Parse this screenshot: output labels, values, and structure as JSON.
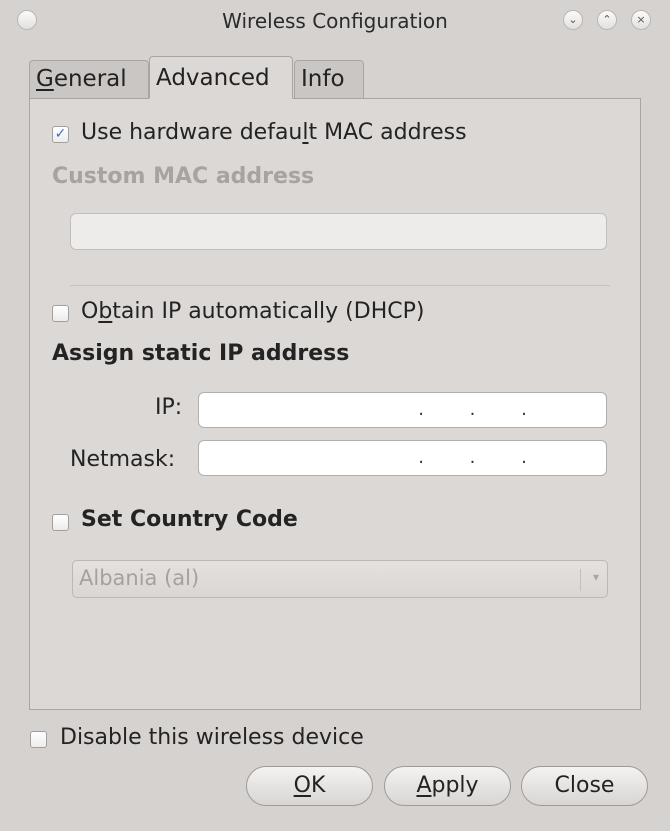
{
  "window": {
    "title": "Wireless Configuration"
  },
  "tabs": [
    {
      "label": "General",
      "mnemonic": "G",
      "rest": "eneral",
      "active": false
    },
    {
      "label": "Advanced",
      "active": true
    },
    {
      "label": "Info",
      "active": false
    }
  ],
  "advanced": {
    "use_hw_mac": {
      "pre": "Use hardware defau",
      "mnemonic": "l",
      "post": "t MAC address",
      "checked": true
    },
    "custom_mac_heading": "Custom MAC address",
    "custom_mac_value": "",
    "dhcp": {
      "pre": "O",
      "mnemonic": "b",
      "post": "tain IP automatically (DHCP)",
      "checked": false
    },
    "static_heading": "Assign static IP address",
    "ip_label": "IP:",
    "ip_value": ". . .",
    "netmask_label": "Netmask:",
    "netmask_value": ". . .",
    "country_label": "Set Country Code",
    "country_checked": false,
    "country_value": "Albania (al)"
  },
  "footer": {
    "disable_label": "Disable this wireless device",
    "disable_checked": false,
    "ok": {
      "mnemonic": "O",
      "rest": "K"
    },
    "apply": {
      "mnemonic": "A",
      "rest": "pply"
    },
    "close": "Close"
  },
  "icons": {
    "checkmark": "✓",
    "min": "⌄",
    "max": "⌃",
    "close": "×",
    "combo_arrow": "▾"
  }
}
